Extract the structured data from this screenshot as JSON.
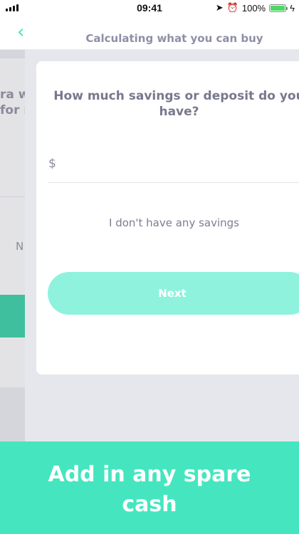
{
  "status_bar": {
    "time": "09:41",
    "battery": "100%",
    "battery_level": 1.0
  },
  "header": {
    "back_icon": "chevron-left-icon",
    "title": "Calculating what you can buy"
  },
  "background_page": {
    "text_line_1": "ra w",
    "text_line_2": "for r",
    "letter": "N"
  },
  "card": {
    "question": "How much savings or deposit do you have?",
    "currency_symbol": "$",
    "amount_value": "",
    "no_savings_label": "I don't have any savings",
    "next_label": "Next"
  },
  "promo": {
    "line_1": "Add in any spare",
    "line_2": "cash"
  },
  "colors": {
    "accent": "#45e6bf",
    "button_disabled": "#8ff2dc",
    "text_muted": "#77788e"
  }
}
